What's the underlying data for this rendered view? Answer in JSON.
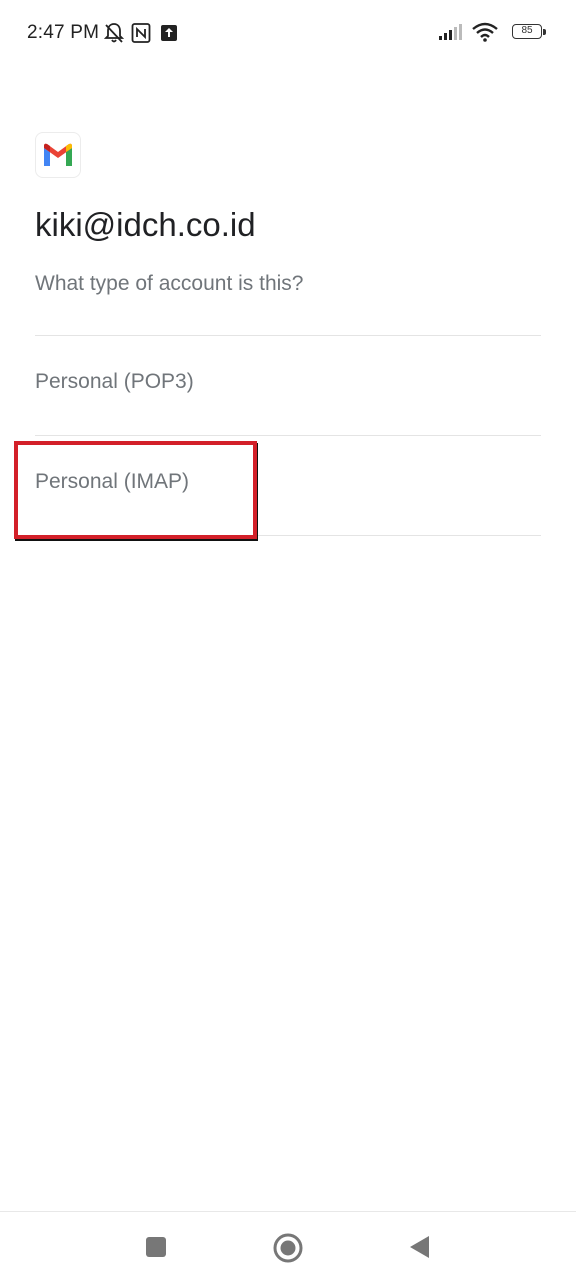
{
  "status_bar": {
    "time": "2:47 PM",
    "left_icons": [
      "bell-off-icon",
      "nfc-icon",
      "upload-icon"
    ],
    "right_icons": [
      "signal-icon",
      "wifi-icon",
      "battery-icon"
    ],
    "battery_level": "85"
  },
  "app": {
    "logo": "gmail-icon",
    "email": "kiki@idch.co.id",
    "question": "What type of account is this?",
    "options": [
      {
        "label": "Personal (POP3)"
      },
      {
        "label": "Personal (IMAP)"
      }
    ],
    "highlighted_option": "Personal (IMAP)",
    "highlight_color": "#d32029"
  },
  "nav_bar": {
    "buttons": [
      "recents-button",
      "home-button",
      "back-button"
    ]
  }
}
